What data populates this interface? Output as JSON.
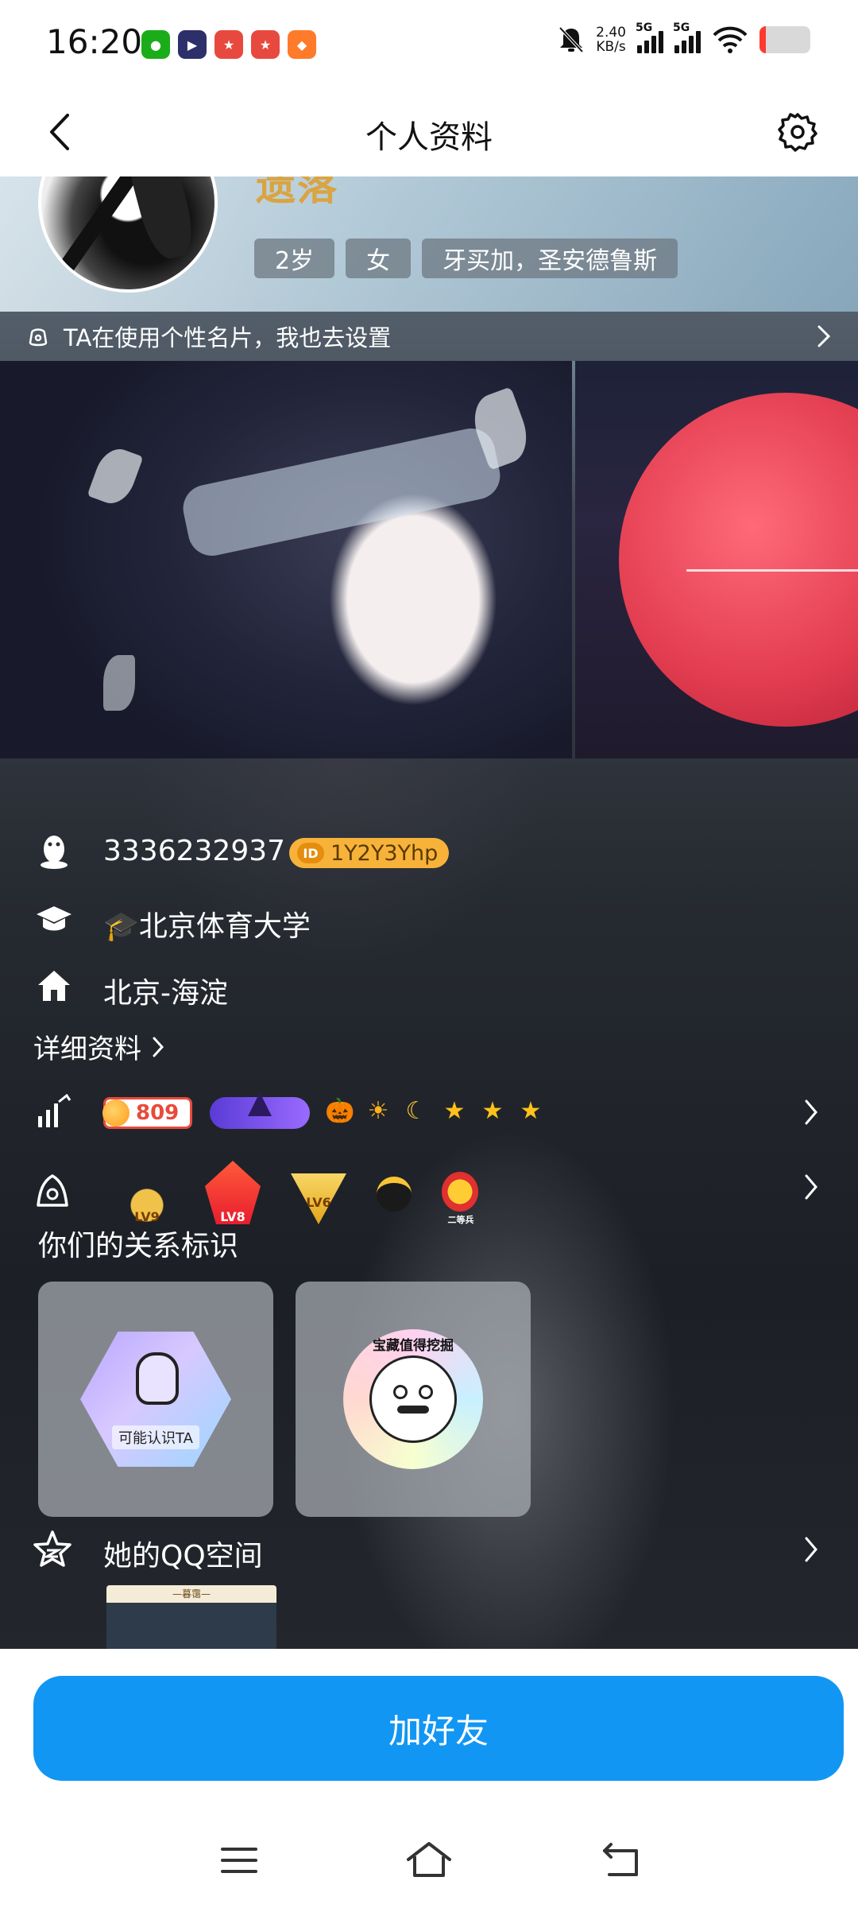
{
  "status_bar": {
    "time": "16:20",
    "net_speed_value": "2.40",
    "net_speed_unit": "KB/s",
    "signal1_label": "5G",
    "signal2_label": "5G",
    "notif_apps": [
      "wechat",
      "video",
      "game",
      "game",
      "shop"
    ]
  },
  "header": {
    "title": "个人资料"
  },
  "profile": {
    "nickname": "遗落",
    "tags": [
      "2岁",
      "女",
      "牙买加，圣安德鲁斯"
    ],
    "card_banner_text": "TA在使用个性名片，我也去设置",
    "qq_number": "3336232937",
    "qid": "1Y2Y3Yhp",
    "qid_mark": "ID",
    "school": "🎓北京体育大学",
    "location": "北京-海淀",
    "detail_link": "详细资料",
    "coins": "809",
    "level_icons": [
      "🎃",
      "☀",
      "☾",
      "★",
      "★",
      "★"
    ],
    "game_badges": [
      "LV9",
      "LV8",
      "LV6",
      "",
      "二等兵"
    ],
    "relation_title": "你们的关系标识",
    "relation_cards": [
      {
        "label": "可能认识TA"
      },
      {
        "label": "宝藏值得挖掘"
      }
    ],
    "qzone_label": "她的QQ空间",
    "qzone_thumb_title": "—暮霭—"
  },
  "actions": {
    "add_friend": "加好友"
  },
  "colors": {
    "accent": "#1296f3",
    "nickname": "#d9a441",
    "qid_badge": "#f7b23a"
  }
}
